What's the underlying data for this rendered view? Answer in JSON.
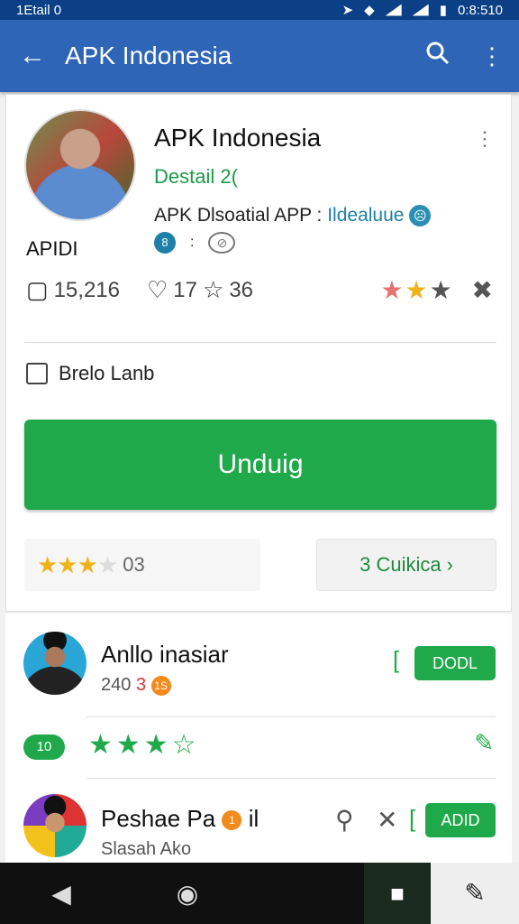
{
  "status": {
    "left": "1Etail 0",
    "time": "0:8:510"
  },
  "appbar": {
    "title": "APK Indonesia"
  },
  "app": {
    "name": "APK Indonesia",
    "subtitle": "Destail 2(",
    "desc": "APK Dlsoatial APP :",
    "desc_highlight": "Ildealuue",
    "tag": "APIDI",
    "downloads": "15,216",
    "comments": "17",
    "star_count": "36",
    "rating_stars": "★★★",
    "checkbox_label": "Brelo Lanb",
    "download_button": "Unduig",
    "rating_value": "03",
    "reviews_link": "3 Cuikica"
  },
  "reviews": [
    {
      "name": "Anllo inasiar",
      "sub_prefix": "240",
      "sub_red": "3",
      "badge": "1S",
      "button": "DODL",
      "pill": "10",
      "stars": "★★★☆"
    },
    {
      "name": "Peshae Pa",
      "name_suffix": "il",
      "badge": "1",
      "sub": "Slasah Ako",
      "button": "ADID"
    }
  ],
  "icons": {
    "back": "arrow-left",
    "search": "search",
    "more": "more-vert",
    "nav_back": "triangle-back",
    "nav_home": "circle-home",
    "nav_recent": "square-recent",
    "nav_edit": "edit"
  },
  "colors": {
    "primary": "#2e65b7",
    "accent": "#1fa94a",
    "star": "#f0b21a"
  }
}
